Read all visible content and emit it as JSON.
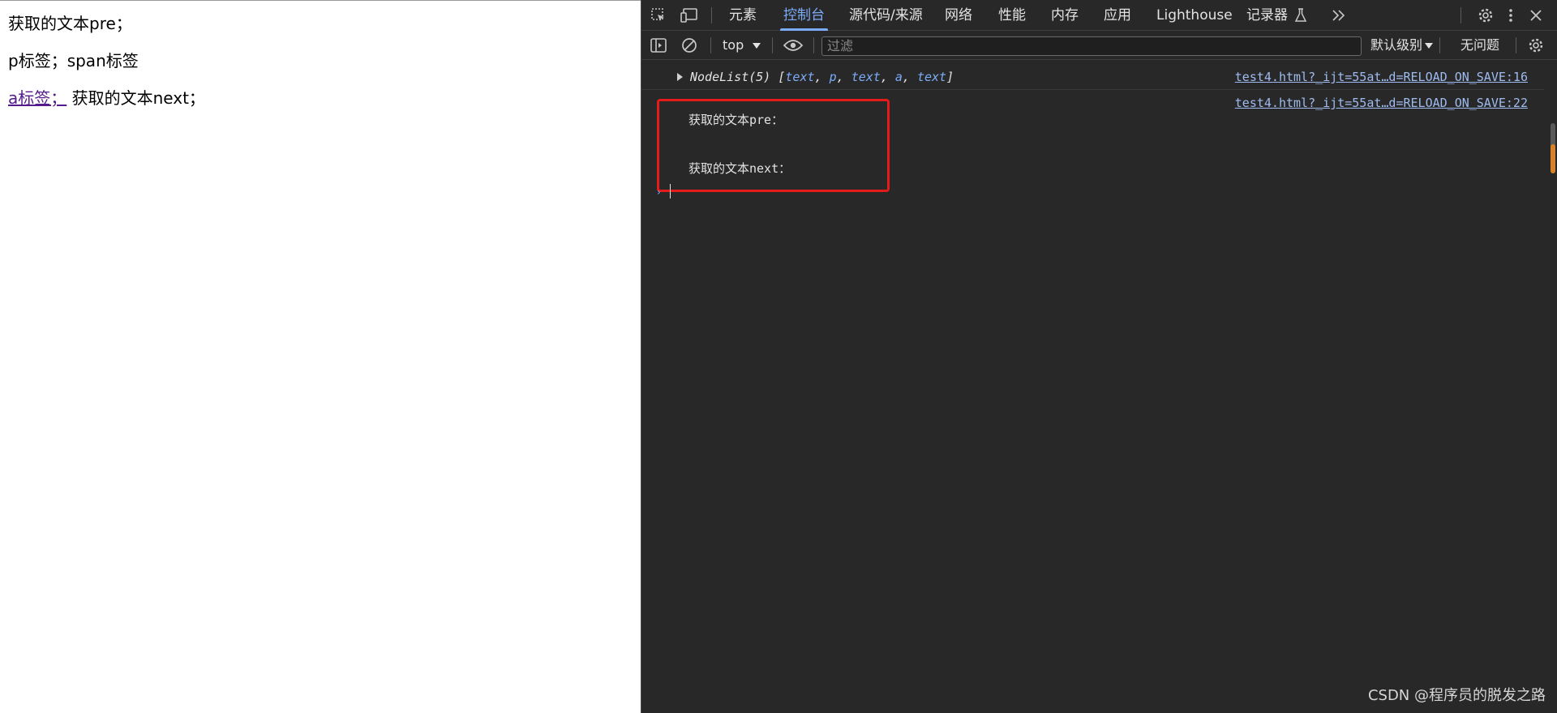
{
  "page": {
    "line1": "获取的文本pre；",
    "line2": "p标签；span标签",
    "link_text": "a标签；",
    "line3_rest": " 获取的文本next；"
  },
  "devtools": {
    "tabs": [
      {
        "label": "元素"
      },
      {
        "label": "控制台"
      },
      {
        "label": "源代码/来源"
      },
      {
        "label": "网络"
      },
      {
        "label": "性能"
      },
      {
        "label": "内存"
      },
      {
        "label": "应用"
      },
      {
        "label": "Lighthouse"
      },
      {
        "label": "记录器"
      }
    ],
    "active_tab": "控制台",
    "context": "top",
    "filter_placeholder": "过滤",
    "level": "默认级别",
    "issues": "无问题",
    "console": {
      "nodelist_prefix": "NodeList(5) [",
      "nodelist_items": [
        "text",
        "p",
        "text",
        "a",
        "text"
      ],
      "nodelist_suffix": "]",
      "source1": "test4.html?_ijt=55at…d=RELOAD_ON_SAVE:16",
      "source2": "test4.html?_ijt=55at…d=RELOAD_ON_SAVE:22",
      "log_line1": "获取的文本pre：",
      "log_line2": "获取的文本next："
    }
  },
  "watermark": "CSDN @程序员的脱发之路",
  "colors": {
    "accent": "#7cacf8",
    "highlight_box": "#e31b1b",
    "panel_bg": "#282828"
  }
}
